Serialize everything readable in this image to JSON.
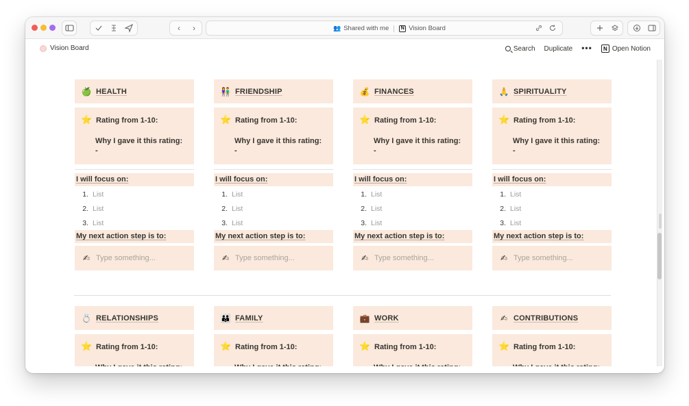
{
  "browser": {
    "url_breadcrumb_1": "Shared with me",
    "url_breadcrumb_2": "Vision Board",
    "back_icon": "‹",
    "forward_icon": "›"
  },
  "notion": {
    "page_title": "Vision Board",
    "search_label": "Search",
    "duplicate_label": "Duplicate",
    "more_label": "•••",
    "open_label": "Open Notion"
  },
  "labels": {
    "rating": "Rating from 1-10:",
    "why": "Why I gave it this rating:",
    "dash": "-",
    "focus": "I will focus on:",
    "next_step": "My next action step is to:",
    "type_placeholder": "Type something...",
    "list_item": "List"
  },
  "row1": [
    {
      "title": "HEALTH",
      "icon": "green-apple-icon",
      "glyph": "🍏"
    },
    {
      "title": "FRIENDSHIP",
      "icon": "two-people-icon",
      "glyph": "👫"
    },
    {
      "title": "FINANCES",
      "icon": "money-bag-icon",
      "glyph": "💰"
    },
    {
      "title": "SPIRITUALITY",
      "icon": "praying-hands-icon",
      "glyph": "🙏"
    }
  ],
  "row2": [
    {
      "title": "RELATIONSHIPS",
      "icon": "ring-icon",
      "glyph": "💍"
    },
    {
      "title": "FAMILY",
      "icon": "family-icon",
      "glyph": "👪"
    },
    {
      "title": "WORK",
      "icon": "briefcase-icon",
      "glyph": "💼"
    },
    {
      "title": "CONTRIBUTIONS",
      "icon": "writing-hand-icon",
      "glyph": "✍"
    }
  ],
  "icons": {
    "star": "⭐",
    "writing": "✍"
  },
  "list_numbers": [
    "1.",
    "2.",
    "3."
  ]
}
